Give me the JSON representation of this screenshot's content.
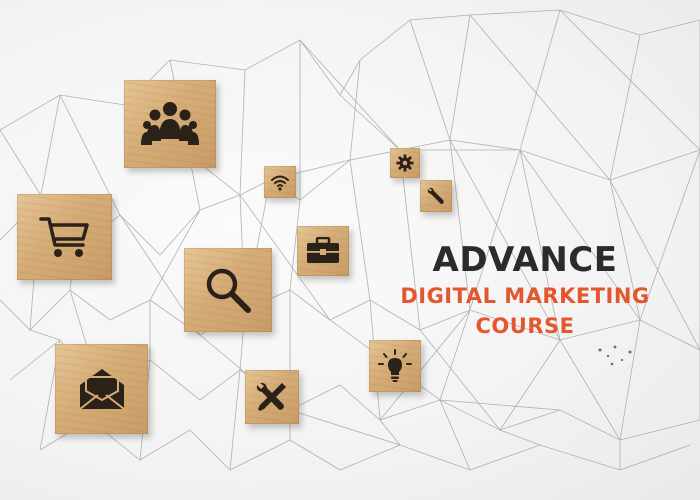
{
  "headline": {
    "line1": "ADVANCE",
    "line2": "DIGITAL MARKETING",
    "line3": "COURSE"
  },
  "colors": {
    "headline_dark": "#2b2b2b",
    "headline_accent": "#e4572e",
    "wood": "#d5ac77",
    "network_lines": "#9a9a9a"
  },
  "blocks": [
    {
      "icon": "people-group-icon"
    },
    {
      "icon": "wifi-icon"
    },
    {
      "icon": "gear-icon"
    },
    {
      "icon": "wrench-icon"
    },
    {
      "icon": "shopping-cart-icon"
    },
    {
      "icon": "briefcase-icon"
    },
    {
      "icon": "magnifier-icon"
    },
    {
      "icon": "envelope-icon"
    },
    {
      "icon": "tools-icon"
    },
    {
      "icon": "lightbulb-icon"
    }
  ]
}
